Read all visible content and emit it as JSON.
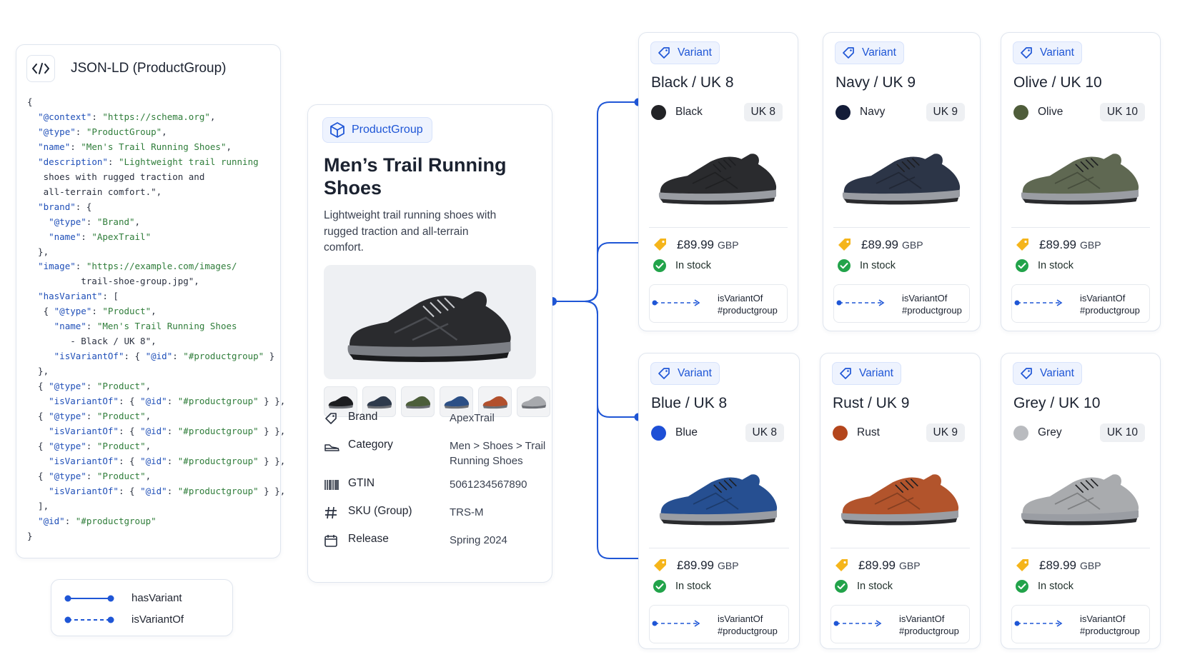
{
  "json_panel": {
    "title": "JSON-LD (ProductGroup)",
    "icon": "code-brackets-icon",
    "lines": [
      "{",
      "  \"@context\": \"https://schema.org\",",
      "  \"@type\": \"ProductGroup\",",
      "  \"name\": \"Men's Trail Running Shoes\",",
      "  \"description\": \"Lightweight trail running",
      "   shoes with rugged traction and",
      "   all-terrain comfort.\",",
      "  \"brand\": {",
      "    \"@type\": \"Brand\",",
      "    \"name\": \"ApexTrail\"",
      "  },",
      "  \"image\": \"https://example.com/images/",
      "          trail-shoe-group.jpg\",",
      "  \"hasVariant\": [",
      "   { \"@type\": \"Product\",",
      "     \"name\": \"Men's Trail Running Shoes",
      "        - Black / UK 8\",",
      "     \"isVariantOf\": { \"@id\": \"#productgroup\" }",
      "  },",
      "  { \"@type\": \"Product\",",
      "    \"isVariantOf\": { \"@id\": \"#productgroup\" } },",
      "  { \"@type\": \"Product\",",
      "    \"isVariantOf\": { \"@id\": \"#productgroup\" } },",
      "  { \"@type\": \"Product\",",
      "    \"isVariantOf\": { \"@id\": \"#productgroup\" } },",
      "  { \"@type\": \"Product\",",
      "    \"isVariantOf\": { \"@id\": \"#productgroup\" } },",
      "  ],",
      "  \"@id\": \"#productgroup\"",
      "}"
    ]
  },
  "legend": {
    "items": [
      {
        "label": "hasVariant",
        "style": "solid"
      },
      {
        "label": "isVariantOf",
        "style": "dashed"
      }
    ]
  },
  "product_group": {
    "badge": "ProductGroup",
    "title": "Men’s Trail Running Shoes",
    "description": "Lightweight trail running shoes with rugged traction and all-terrain comfort.",
    "swatch_colors": [
      "#1c1d20",
      "#2e3a4c",
      "#4c5e3a",
      "#2b4f86",
      "#b2502d",
      "#a7a9ad"
    ],
    "specs": [
      {
        "label": "Brand",
        "value": "ApexTrail",
        "icon": "tag-icon"
      },
      {
        "label": "Category",
        "value": "Men > Shoes > Trail Running Shoes",
        "icon": "shoe-icon"
      },
      {
        "label": "GTIN",
        "value": "5061234567890",
        "icon": "barcode-icon"
      },
      {
        "label": "SKU (Group)",
        "value": "TRS-M",
        "icon": "hash-icon"
      },
      {
        "label": "Release",
        "value": "Spring 2024",
        "icon": "calendar-icon"
      }
    ]
  },
  "variants": [
    {
      "badge": "Variant",
      "title": "Black / UK 8",
      "color_name": "Black",
      "color": "#222326",
      "size": "UK 8",
      "price": "£89.99",
      "currency": "GBP",
      "stock": "In stock",
      "rel_label": "isVariantOf",
      "rel_target": "#productgroup",
      "shoe_color": "#2a2b2e"
    },
    {
      "badge": "Variant",
      "title": "Navy / UK 9",
      "color_name": "Navy",
      "color": "#131c38",
      "size": "UK 9",
      "price": "£89.99",
      "currency": "GBP",
      "stock": "In stock",
      "rel_label": "isVariantOf",
      "rel_target": "#productgroup",
      "shoe_color": "#2c3547"
    },
    {
      "badge": "Variant",
      "title": "Olive / UK 10",
      "color_name": "Olive",
      "color": "#4f5d3a",
      "size": "UK 10",
      "price": "£89.99",
      "currency": "GBP",
      "stock": "In stock",
      "rel_label": "isVariantOf",
      "rel_target": "#productgroup",
      "shoe_color": "#5f6852"
    },
    {
      "badge": "Variant",
      "title": "Blue / UK 8",
      "color_name": "Blue",
      "color": "#1d4fd6",
      "size": "UK 8",
      "price": "£89.99",
      "currency": "GBP",
      "stock": "In stock",
      "rel_label": "isVariantOf",
      "rel_target": "#productgroup",
      "shoe_color": "#264f91"
    },
    {
      "badge": "Variant",
      "title": "Rust / UK 9",
      "color_name": "Rust",
      "color": "#b4461c",
      "size": "UK 9",
      "price": "£89.99",
      "currency": "GBP",
      "stock": "In stock",
      "rel_label": "isVariantOf",
      "rel_target": "#productgroup",
      "shoe_color": "#b2542c"
    },
    {
      "badge": "Variant",
      "title": "Grey / UK 10",
      "color_name": "Grey",
      "color": "#b9bbbf",
      "size": "UK 10",
      "price": "£89.99",
      "currency": "GBP",
      "stock": "In stock",
      "rel_label": "isVariantOf",
      "rel_target": "#productgroup",
      "shoe_color": "#a9abae"
    }
  ],
  "colors": {
    "accent": "#1f56d6",
    "connector": "#1f56d6",
    "price_tag": "#f5b51b",
    "in_stock": "#22a34a"
  }
}
